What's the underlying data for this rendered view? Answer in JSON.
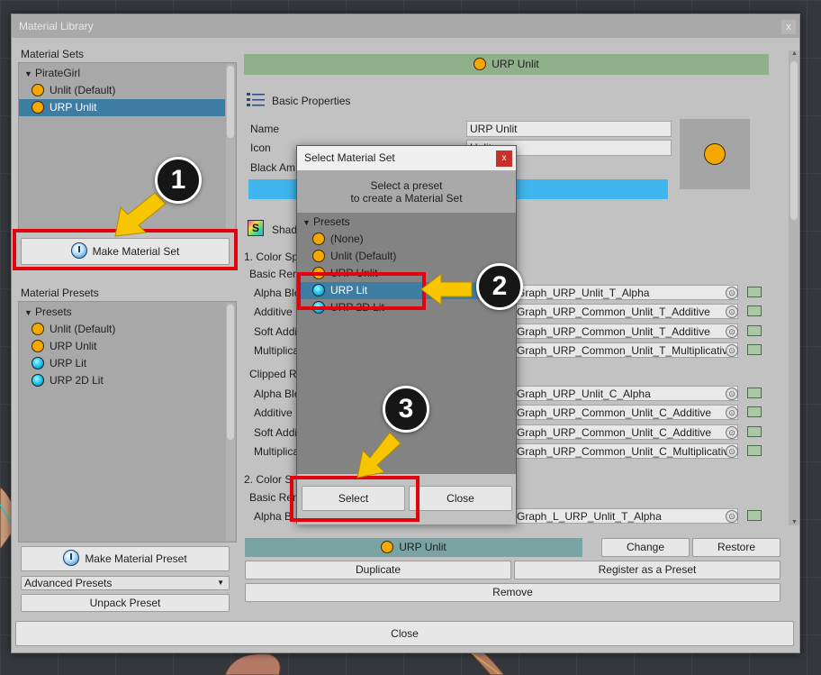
{
  "window": {
    "title": "Material Library",
    "close_glyph": "x"
  },
  "left": {
    "material_sets_label": "Material Sets",
    "sets_tree": {
      "root": "PirateGirl",
      "items": [
        {
          "label": "Unlit (Default)",
          "icon": "orange-circle-icon"
        },
        {
          "label": "URP Unlit",
          "icon": "orange-circle-icon",
          "selected": true
        }
      ]
    },
    "make_set_button": "Make Material Set",
    "material_presets_label": "Material Presets",
    "presets_tree": {
      "root": "Presets",
      "items": [
        {
          "label": "Unlit (Default)",
          "icon": "orange-circle-icon"
        },
        {
          "label": "URP Unlit",
          "icon": "orange-circle-icon"
        },
        {
          "label": "URP Lit",
          "icon": "blue-sphere-icon"
        },
        {
          "label": "URP 2D Lit",
          "icon": "blue-sphere-icon"
        }
      ]
    },
    "make_preset_button": "Make Material Preset",
    "advanced_presets": "Advanced Presets",
    "unpack_preset_button": "Unpack Preset"
  },
  "right": {
    "header_title": "URP Unlit",
    "basic_properties": "Basic Properties",
    "fields": {
      "name_label": "Name",
      "name_value": "URP Unlit",
      "icon_label": "Icon",
      "icon_value": "Unlit",
      "black_label": "Black Am"
    },
    "shader_label": "Shad",
    "section1": "1. Color Sp",
    "basic_render": "Basic Ren",
    "rows1": [
      {
        "label": "Alpha Ble",
        "value": "Graph_URP_Unlit_T_Alpha"
      },
      {
        "label": "Additive",
        "value": "Graph_URP_Common_Unlit_T_Additive"
      },
      {
        "label": "Soft Addi",
        "value": "Graph_URP_Common_Unlit_T_Additive"
      },
      {
        "label": "Multiplica",
        "value": "Graph_URP_Common_Unlit_T_Multiplicativ"
      }
    ],
    "clipped_render": "Clipped R",
    "rows2": [
      {
        "label": "Alpha Ble",
        "value": "Graph_URP_Unlit_C_Alpha"
      },
      {
        "label": "Additive",
        "value": "Graph_URP_Common_Unlit_C_Additive"
      },
      {
        "label": "Soft Addi",
        "value": "Graph_URP_Common_Unlit_C_Additive"
      },
      {
        "label": "Multiplica",
        "value": "Graph_URP_Common_Unlit_C_Multiplicativ"
      }
    ],
    "section2": "2. Color S",
    "basic_render2": "Basic Ren",
    "row3": {
      "label": "Alpha Bl",
      "value": "Graph_L_URP_Unlit_T_Alpha"
    },
    "bottom": {
      "current": "URP Unlit",
      "change": "Change",
      "restore": "Restore",
      "duplicate": "Duplicate",
      "register": "Register as a Preset",
      "remove": "Remove"
    }
  },
  "close_button": "Close",
  "dialog": {
    "title": "Select Material Set",
    "close_glyph": "x",
    "desc_line1": "Select a preset",
    "desc_line2": "to create a Material Set",
    "tree_root": "Presets",
    "items": [
      {
        "label": "(None)",
        "icon": "orange-circle-icon"
      },
      {
        "label": "Unlit (Default)",
        "icon": "orange-circle-icon"
      },
      {
        "label": "URP Unlit",
        "icon": "orange-circle-icon"
      },
      {
        "label": "URP Lit",
        "icon": "blue-sphere-icon",
        "selected": true
      },
      {
        "label": "URP 2D Lit",
        "icon": "blue-sphere-icon"
      }
    ],
    "select_button": "Select",
    "close_button": "Close"
  },
  "callouts": [
    "1",
    "2",
    "3"
  ],
  "colors": {
    "highlight": "#e3000f",
    "arrow": "#f7c600",
    "selection": "#3d7ca3",
    "header": "#8fb08a"
  }
}
